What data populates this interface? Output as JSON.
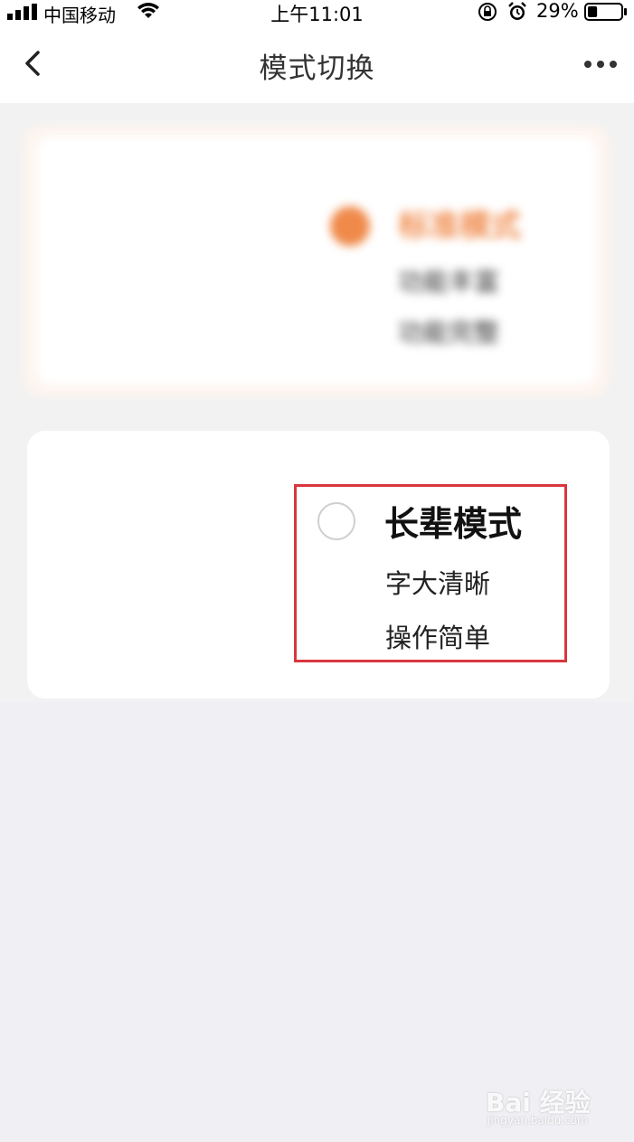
{
  "status_bar": {
    "carrier": "中国移动",
    "time": "上午11:01",
    "battery_percent": "29%",
    "battery_level": 0.29,
    "icons": [
      "signal-icon",
      "wifi-icon",
      "rotation-lock-icon",
      "alarm-icon",
      "battery-icon"
    ]
  },
  "nav": {
    "title": "模式切换",
    "back_icon": "chevron-left-icon",
    "more_icon": "more-dots-icon"
  },
  "standard_mode": {
    "title": "标准模式",
    "lines": [
      "功能丰富",
      "功能完整"
    ],
    "selected": true,
    "accent": "#f08a4b"
  },
  "elder_mode": {
    "title": "长辈模式",
    "lines": [
      "字大清晰",
      "操作简单"
    ],
    "selected": false
  },
  "watermark": {
    "text": "Bai 经验",
    "sub": "jingyan.baidu.com"
  },
  "colors": {
    "highlight_border": "#d9363e",
    "background": "#efeff4"
  }
}
